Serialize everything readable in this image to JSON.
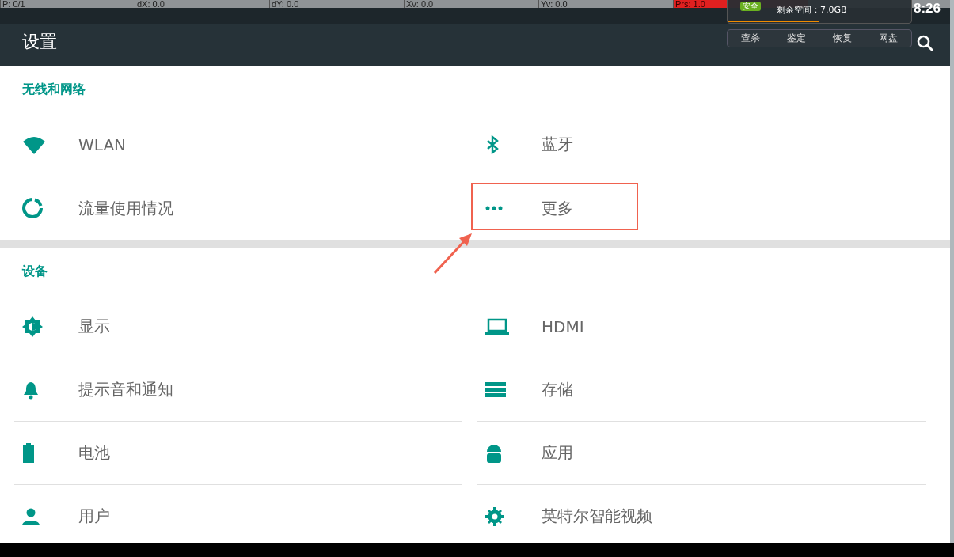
{
  "pointer_bar": {
    "cells": [
      {
        "text": "P: 0/1",
        "kind": "normal"
      },
      {
        "text": "dX: 0.0",
        "kind": "normal"
      },
      {
        "text": "dY: 0.0",
        "kind": "normal"
      },
      {
        "text": "Xv: 0.0",
        "kind": "normal"
      },
      {
        "text": "Yv: 0.0",
        "kind": "normal"
      },
      {
        "text": "Prs: 1.0",
        "kind": "alert"
      }
    ]
  },
  "status_bar": {
    "time": "8:26"
  },
  "popup": {
    "badge": "安全",
    "free_space": "剩余空间：7.0GB",
    "level": 0.5,
    "buttons": [
      "查杀",
      "鉴定",
      "恢复",
      "网盘"
    ]
  },
  "app_bar": {
    "title": "设置"
  },
  "sections": [
    {
      "title": "无线和网络",
      "items": [
        {
          "label": "WLAN",
          "highlighted": false
        },
        {
          "label": "蓝牙",
          "highlighted": false
        },
        {
          "label": "流量使用情况",
          "highlighted": false
        },
        {
          "label": "更多",
          "highlighted": true
        }
      ]
    },
    {
      "title": "设备",
      "items": [
        {
          "label": "显示",
          "highlighted": false
        },
        {
          "label": "HDMI",
          "highlighted": false
        },
        {
          "label": "提示音和通知",
          "highlighted": false
        },
        {
          "label": "存储",
          "highlighted": false
        },
        {
          "label": "电池",
          "highlighted": false
        },
        {
          "label": "应用",
          "highlighted": false
        },
        {
          "label": "用户",
          "highlighted": false
        },
        {
          "label": "英特尔智能视频",
          "highlighted": false
        }
      ]
    }
  ]
}
